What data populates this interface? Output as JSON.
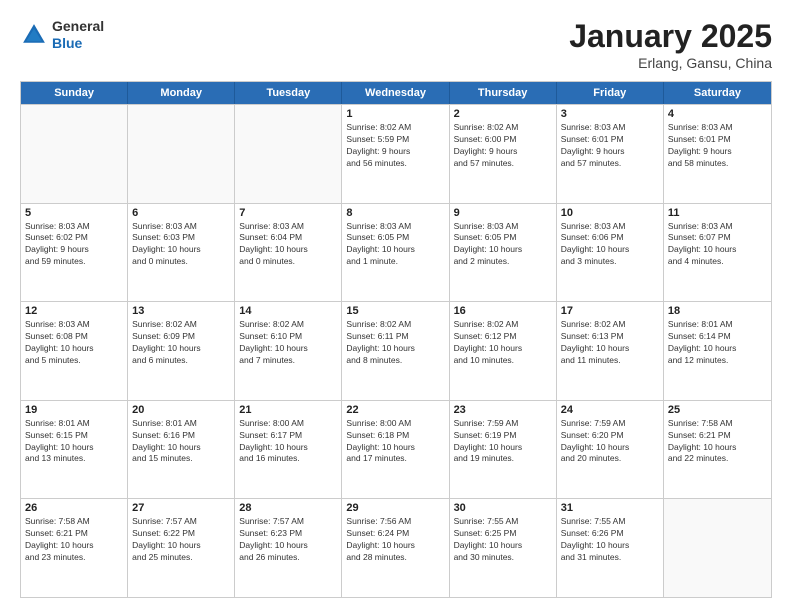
{
  "header": {
    "logo_general": "General",
    "logo_blue": "Blue",
    "title": "January 2025",
    "location": "Erlang, Gansu, China"
  },
  "days_of_week": [
    "Sunday",
    "Monday",
    "Tuesday",
    "Wednesday",
    "Thursday",
    "Friday",
    "Saturday"
  ],
  "weeks": [
    [
      {
        "day": "",
        "info": ""
      },
      {
        "day": "",
        "info": ""
      },
      {
        "day": "",
        "info": ""
      },
      {
        "day": "1",
        "info": "Sunrise: 8:02 AM\nSunset: 5:59 PM\nDaylight: 9 hours\nand 56 minutes."
      },
      {
        "day": "2",
        "info": "Sunrise: 8:02 AM\nSunset: 6:00 PM\nDaylight: 9 hours\nand 57 minutes."
      },
      {
        "day": "3",
        "info": "Sunrise: 8:03 AM\nSunset: 6:01 PM\nDaylight: 9 hours\nand 57 minutes."
      },
      {
        "day": "4",
        "info": "Sunrise: 8:03 AM\nSunset: 6:01 PM\nDaylight: 9 hours\nand 58 minutes."
      }
    ],
    [
      {
        "day": "5",
        "info": "Sunrise: 8:03 AM\nSunset: 6:02 PM\nDaylight: 9 hours\nand 59 minutes."
      },
      {
        "day": "6",
        "info": "Sunrise: 8:03 AM\nSunset: 6:03 PM\nDaylight: 10 hours\nand 0 minutes."
      },
      {
        "day": "7",
        "info": "Sunrise: 8:03 AM\nSunset: 6:04 PM\nDaylight: 10 hours\nand 0 minutes."
      },
      {
        "day": "8",
        "info": "Sunrise: 8:03 AM\nSunset: 6:05 PM\nDaylight: 10 hours\nand 1 minute."
      },
      {
        "day": "9",
        "info": "Sunrise: 8:03 AM\nSunset: 6:05 PM\nDaylight: 10 hours\nand 2 minutes."
      },
      {
        "day": "10",
        "info": "Sunrise: 8:03 AM\nSunset: 6:06 PM\nDaylight: 10 hours\nand 3 minutes."
      },
      {
        "day": "11",
        "info": "Sunrise: 8:03 AM\nSunset: 6:07 PM\nDaylight: 10 hours\nand 4 minutes."
      }
    ],
    [
      {
        "day": "12",
        "info": "Sunrise: 8:03 AM\nSunset: 6:08 PM\nDaylight: 10 hours\nand 5 minutes."
      },
      {
        "day": "13",
        "info": "Sunrise: 8:02 AM\nSunset: 6:09 PM\nDaylight: 10 hours\nand 6 minutes."
      },
      {
        "day": "14",
        "info": "Sunrise: 8:02 AM\nSunset: 6:10 PM\nDaylight: 10 hours\nand 7 minutes."
      },
      {
        "day": "15",
        "info": "Sunrise: 8:02 AM\nSunset: 6:11 PM\nDaylight: 10 hours\nand 8 minutes."
      },
      {
        "day": "16",
        "info": "Sunrise: 8:02 AM\nSunset: 6:12 PM\nDaylight: 10 hours\nand 10 minutes."
      },
      {
        "day": "17",
        "info": "Sunrise: 8:02 AM\nSunset: 6:13 PM\nDaylight: 10 hours\nand 11 minutes."
      },
      {
        "day": "18",
        "info": "Sunrise: 8:01 AM\nSunset: 6:14 PM\nDaylight: 10 hours\nand 12 minutes."
      }
    ],
    [
      {
        "day": "19",
        "info": "Sunrise: 8:01 AM\nSunset: 6:15 PM\nDaylight: 10 hours\nand 13 minutes."
      },
      {
        "day": "20",
        "info": "Sunrise: 8:01 AM\nSunset: 6:16 PM\nDaylight: 10 hours\nand 15 minutes."
      },
      {
        "day": "21",
        "info": "Sunrise: 8:00 AM\nSunset: 6:17 PM\nDaylight: 10 hours\nand 16 minutes."
      },
      {
        "day": "22",
        "info": "Sunrise: 8:00 AM\nSunset: 6:18 PM\nDaylight: 10 hours\nand 17 minutes."
      },
      {
        "day": "23",
        "info": "Sunrise: 7:59 AM\nSunset: 6:19 PM\nDaylight: 10 hours\nand 19 minutes."
      },
      {
        "day": "24",
        "info": "Sunrise: 7:59 AM\nSunset: 6:20 PM\nDaylight: 10 hours\nand 20 minutes."
      },
      {
        "day": "25",
        "info": "Sunrise: 7:58 AM\nSunset: 6:21 PM\nDaylight: 10 hours\nand 22 minutes."
      }
    ],
    [
      {
        "day": "26",
        "info": "Sunrise: 7:58 AM\nSunset: 6:21 PM\nDaylight: 10 hours\nand 23 minutes."
      },
      {
        "day": "27",
        "info": "Sunrise: 7:57 AM\nSunset: 6:22 PM\nDaylight: 10 hours\nand 25 minutes."
      },
      {
        "day": "28",
        "info": "Sunrise: 7:57 AM\nSunset: 6:23 PM\nDaylight: 10 hours\nand 26 minutes."
      },
      {
        "day": "29",
        "info": "Sunrise: 7:56 AM\nSunset: 6:24 PM\nDaylight: 10 hours\nand 28 minutes."
      },
      {
        "day": "30",
        "info": "Sunrise: 7:55 AM\nSunset: 6:25 PM\nDaylight: 10 hours\nand 30 minutes."
      },
      {
        "day": "31",
        "info": "Sunrise: 7:55 AM\nSunset: 6:26 PM\nDaylight: 10 hours\nand 31 minutes."
      },
      {
        "day": "",
        "info": ""
      }
    ]
  ]
}
